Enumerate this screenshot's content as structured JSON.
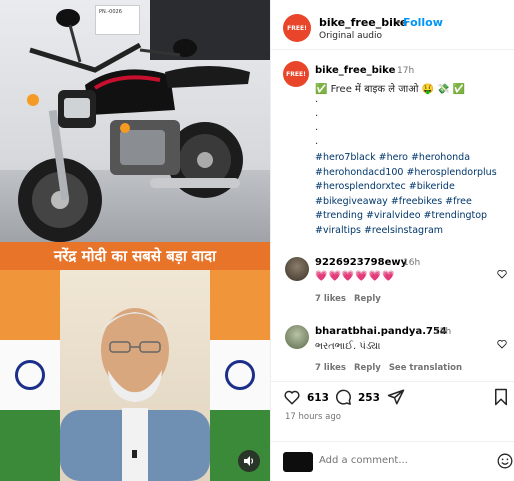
{
  "media": {
    "banner_text": "PN.-0026",
    "caption": "नरेंद्र मोदी का सबसे बड़ा वादा"
  },
  "header": {
    "avatar_text": "FREE!",
    "username": "bike_free_bike",
    "dot": "•",
    "follow": "Follow",
    "audio": "Original audio"
  },
  "post": {
    "avatar_text": "FREE!",
    "username": "bike_free_bike",
    "time": "17h",
    "caption_line": "✅ Free में बाइक ले जाओ 🤑 💸 ✅",
    "dots": [
      ".",
      ".",
      ".",
      "."
    ],
    "hashtags": "#hero7black #hero #herohonda #herohondacd100 #herosplendorplus #herosplendorxtec #bikeride #bikegiveaway #freebikes #free #trending #viralvideo #trendingtop #viraltips #reelsinstagram"
  },
  "comments": [
    {
      "username": "9226923798ewy",
      "time": "16h",
      "text": "💗💗💗💗💗💗",
      "likes": "7 likes",
      "reply": "Reply"
    },
    {
      "username": "bharatbhai.pandya.754",
      "time": "15h",
      "text": "ભરતભાઈ. પંડ્યા",
      "likes": "7 likes",
      "reply": "Reply",
      "translate": "See translation"
    }
  ],
  "actions": {
    "likes_count": "613",
    "comments_count": "253",
    "time_ago": "17 hours ago"
  },
  "add_comment": {
    "placeholder": "Add a comment..."
  },
  "colors": {
    "accent": "#0095f6",
    "brand_avatar": "#e8452a",
    "caption_bar": "#e8742a",
    "hashtag": "#00376b"
  }
}
